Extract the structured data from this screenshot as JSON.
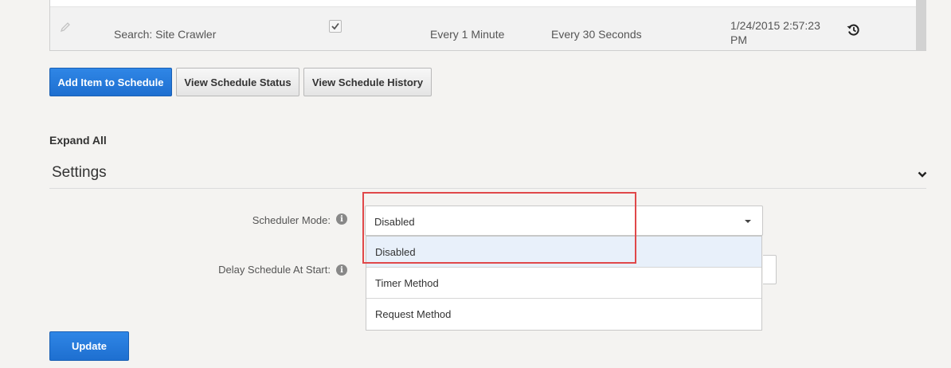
{
  "table": {
    "row": {
      "name": "Search: Site Crawler",
      "enabled": true,
      "frequency": "Every 1 Minute",
      "interval": "Every 30 Seconds",
      "last_run": "1/24/2015 2:57:23 PM"
    }
  },
  "toolbar": {
    "add_label": "Add Item to Schedule",
    "status_label": "View Schedule Status",
    "history_label": "View Schedule History"
  },
  "expand_all_label": "Expand All",
  "settings": {
    "title": "Settings",
    "scheduler_mode_label": "Scheduler Mode:",
    "scheduler_mode_value": "Disabled",
    "delay_label": "Delay Schedule At Start:",
    "options": [
      "Disabled",
      "Timer Method",
      "Request Method"
    ]
  },
  "update_label": "Update",
  "colors": {
    "primary": "#1e6fd0",
    "highlight": "#e0484a",
    "selected_option": "#e8f0fa"
  },
  "icons": {
    "edit": "pencil-icon",
    "history": "history-icon",
    "collapse": "chevron-down-icon",
    "info": "info-icon",
    "dropdown": "caret-down-icon"
  }
}
